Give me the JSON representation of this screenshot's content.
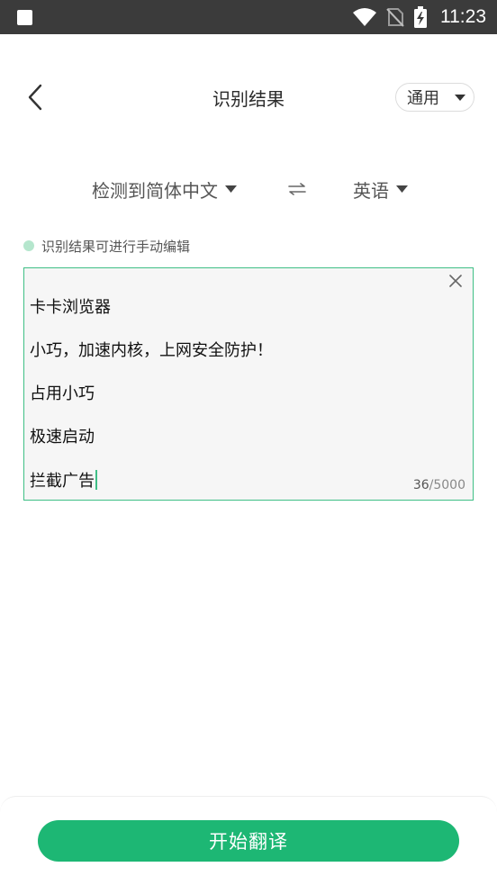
{
  "status_bar": {
    "time": "11:23"
  },
  "header": {
    "title": "识别结果",
    "mode": "通用"
  },
  "languages": {
    "source": "检测到简体中文",
    "swap_symbol": "⇌",
    "target": "英语"
  },
  "hint": {
    "text": "识别结果可进行手动编辑"
  },
  "editor": {
    "lines": [
      "卡卡浏览器",
      "小巧，加速内核，上网安全防护！",
      "占用小巧",
      "极速启动",
      "拦截广告"
    ],
    "count": "36",
    "max": "/5000"
  },
  "actions": {
    "translate_label": "开始翻译"
  },
  "colors": {
    "accent": "#1db774",
    "border_accent": "#3fbf86",
    "status_bar": "#3b3b3b"
  },
  "icons": {
    "back": "chevron-left-icon",
    "dropdown": "caret-down-icon",
    "swap": "swap-arrows-icon",
    "clear": "close-icon"
  }
}
